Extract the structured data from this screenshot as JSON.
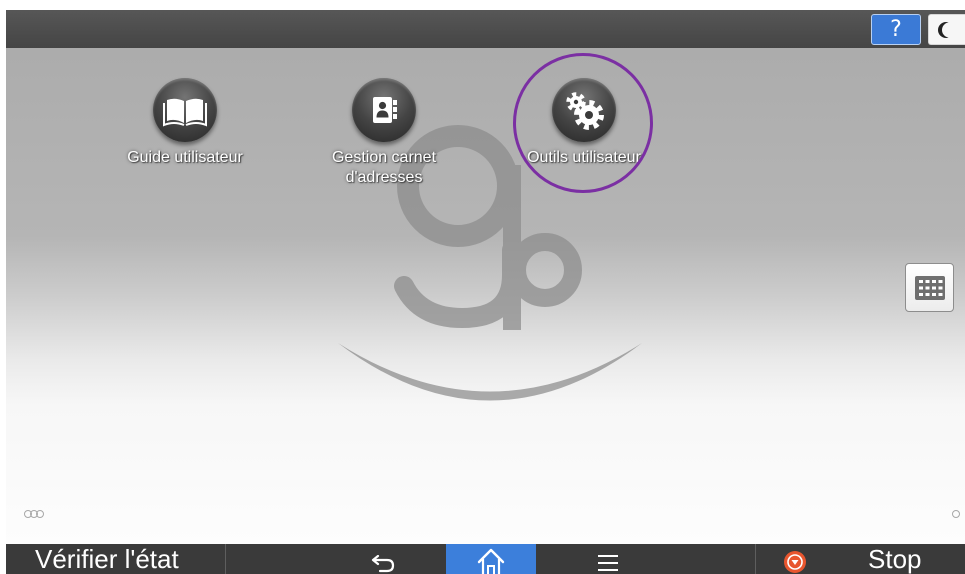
{
  "header": {
    "help_label": "?",
    "help_icon": "help-icon",
    "energy_saver_icon": "moon-icon"
  },
  "background_logo": {
    "icon": "gb-logo-watermark",
    "lettering": "gb"
  },
  "apps": [
    {
      "icon": "book-icon",
      "label": [
        "Guide utilisateur"
      ]
    },
    {
      "icon": "address-book-icon",
      "label": [
        "Gestion carnet",
        "d'adresses"
      ]
    },
    {
      "icon": "gears-icon",
      "label": [
        "Outils utilisateur"
      ]
    }
  ],
  "app_list_button": {
    "icon": "app-grid-icon"
  },
  "footer": {
    "check_status_label": "Vérifier l'état",
    "back_icon": "back-arrow-icon",
    "home_icon": "home-icon",
    "menu_icon": "menu-icon",
    "stop_icon": "stop-icon",
    "stop_label": "Stop"
  },
  "colors": {
    "topbar": "#4a4a4a",
    "help_button": "#3b7ad6",
    "footer": "#3a3a3a",
    "home_active": "#3c7fdb",
    "stop": "#e8562f",
    "annotation": "#7b2fa3"
  }
}
